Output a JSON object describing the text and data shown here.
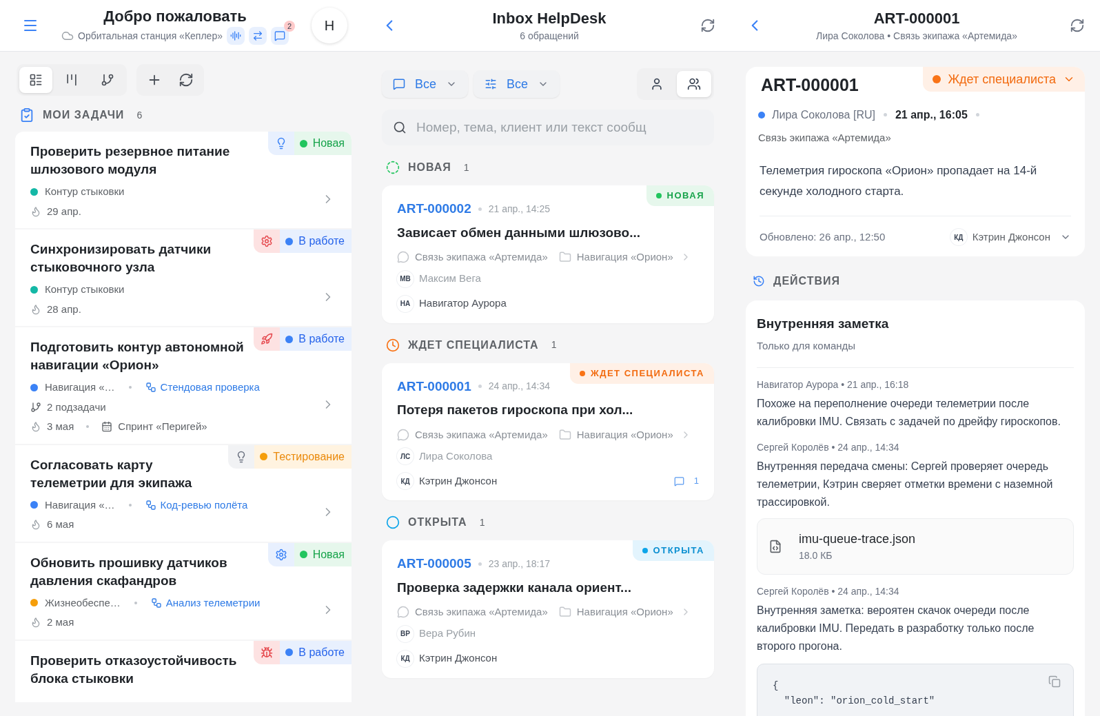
{
  "left_header": {
    "title": "Добро пожаловать",
    "subtitle": "Орбитальная станция «Кеплер»",
    "notification_count": "2",
    "avatar": "Н"
  },
  "middle_header": {
    "title": "Inbox HelpDesk",
    "subtitle": "6 обращений"
  },
  "right_header": {
    "title": "ART-000001",
    "subtitle": "Лира Соколова • Связь экипажа «Артемида»"
  },
  "view_buttons": [
    {
      "kind": "list",
      "selected": true
    },
    {
      "kind": "board",
      "selected": false
    },
    {
      "kind": "tree",
      "selected": false
    }
  ],
  "tasks_section": {
    "title": "МОИ ЗАДАЧИ",
    "count": "6"
  },
  "tasks": [
    {
      "title": "Проверить резервное питание шлюзового модуля",
      "icon": {
        "kind": "idea"
      },
      "priority": {
        "kind": "info"
      },
      "status": {
        "label": "Новая",
        "kind": "new"
      },
      "project": {
        "name": "Контур стыковки",
        "color": "#14b8a6"
      },
      "due": "29 апр."
    },
    {
      "title": "Синхронизировать датчики стыковочного узла",
      "icon": {
        "kind": "gear"
      },
      "priority": {
        "kind": "danger"
      },
      "status": {
        "label": "В работе",
        "kind": "in_progress"
      },
      "project": {
        "name": "Контур стыковки",
        "color": "#14b8a6"
      },
      "due": "28 апр."
    },
    {
      "title": "Подготовить контур автономной навигации «Орион»",
      "icon": {
        "kind": "rocket"
      },
      "priority": {
        "kind": "danger"
      },
      "status": {
        "label": "В работе",
        "kind": "in_progress"
      },
      "project": {
        "name": "Навигация «…",
        "color": "#3b82f6"
      },
      "link": "Стендовая проверка",
      "subtasks": "2 подзадачи",
      "due": "3 мая",
      "sprint": "Спринт «Перигей»"
    },
    {
      "title": "Согласовать карту телеметрии для экипажа",
      "icon": {
        "kind": "idea"
      },
      "priority": {
        "kind": "neutral"
      },
      "status": {
        "label": "Тестирование",
        "kind": "testing"
      },
      "project": {
        "name": "Навигация «…",
        "color": "#3b82f6"
      },
      "link": "Код-ревью полёта",
      "due": "6 мая"
    },
    {
      "title": "Обновить прошивку датчиков давления скафандров",
      "icon": {
        "kind": "gear"
      },
      "priority": {
        "kind": "info"
      },
      "status": {
        "label": "Новая",
        "kind": "new"
      },
      "project": {
        "name": "Жизнеобеспе…",
        "color": "#f59e0b"
      },
      "link": "Анализ телеметрии",
      "due": "2 мая"
    },
    {
      "title": "Проверить отказоустойчивость блока стыковки",
      "icon": {
        "kind": "bug"
      },
      "priority": {
        "kind": "danger"
      },
      "status": {
        "label": "В работе",
        "kind": "in_progress"
      }
    }
  ],
  "filters": [
    {
      "kind": "channel",
      "label": "Все"
    },
    {
      "kind": "settings",
      "label": "Все"
    }
  ],
  "scope_toggles": [
    {
      "kind": "mine",
      "selected": false
    },
    {
      "kind": "team",
      "selected": true
    }
  ],
  "search": {
    "placeholder": "Номер, тема, клиент или текст сообщ"
  },
  "groups": [
    {
      "title": "НОВАЯ",
      "count": "1",
      "kind": "new",
      "tickets": [
        {
          "id": "ART-000002",
          "date": "21 апр., 14:25",
          "title": "Зависает обмен данными шлюзово...",
          "badge": "НОВАЯ",
          "channel": "Связь экипажа «Артемида»",
          "project": "Навигация «Орион»",
          "requester": {
            "initials": "МВ",
            "name": "Максим Вега"
          },
          "assignee": {
            "initials": "НА",
            "name": "Навигатор Аурора"
          }
        }
      ]
    },
    {
      "title": "ЖДЕТ СПЕЦИАЛИСТА",
      "count": "1",
      "kind": "waiting",
      "tickets": [
        {
          "id": "ART-000001",
          "date": "24 апр., 14:34",
          "title": "Потеря пакетов гироскопа при хол...",
          "badge": "ЖДЕТ СПЕЦИАЛИСТА",
          "channel": "Связь экипажа «Артемида»",
          "project": "Навигация «Орион»",
          "requester": {
            "initials": "ЛС",
            "name": "Лира Соколова"
          },
          "assignee": {
            "initials": "КД",
            "name": "Кэтрин Джонсон"
          },
          "comments": "1"
        }
      ]
    },
    {
      "title": "ОТКРЫТА",
      "count": "1",
      "kind": "open",
      "tickets": [
        {
          "id": "ART-000005",
          "date": "23 апр., 18:17",
          "title": "Проверка задержки канала ориент...",
          "badge": "ОТКРЫТА",
          "channel": "Связь экипажа «Артемида»",
          "project": "Навигация «Орион»",
          "requester": {
            "initials": "ВР",
            "name": "Вера Рубин"
          },
          "assignee": {
            "initials": "КД",
            "name": "Кэтрин Джонсон"
          }
        }
      ]
    }
  ],
  "ticket": {
    "id": "ART-000001",
    "status": {
      "label": "Ждет специалиста",
      "kind": "waiting"
    },
    "customer": "Лира Соколова [RU]",
    "date": "21 апр., 16:05",
    "channel": "Связь экипажа «Артемида»",
    "message": "Телеметрия гироскопа «Орион» пропадает на 14-й секунде холодного старта.",
    "updated": "Обновлено: 26 апр., 12:50",
    "assignee": {
      "initials": "КД",
      "name": "Кэтрин Джонсон"
    }
  },
  "actions": {
    "title": "ДЕЙСТВИЯ",
    "note": {
      "title": "Внутренняя заметка",
      "subtitle": "Только для команды"
    },
    "entries": [
      {
        "meta": "Навигатор Аурора • 21 апр., 16:18",
        "text": "Похоже на переполнение очереди телеметрии после калибровки IMU. Связать с задачей по дрейфу гироскопов."
      },
      {
        "meta": "Сергей Королёв • 24 апр., 14:34",
        "text": "Внутренняя передача смены: Сергей проверяет очередь телеметрии, Кэтрин сверяет отметки времени с наземной трассировкой.",
        "attachment": {
          "name": "imu-queue-trace.json",
          "size": "18.0 КБ"
        }
      },
      {
        "meta": "Сергей Королёв • 24 апр., 14:34",
        "text": "Внутренняя заметка: вероятен скачок очереди после калибровки IMU. Передать в разработку только после второго прогона.",
        "code": [
          "{",
          "  \"leon\": \"orion_cold_start\""
        ]
      }
    ]
  }
}
